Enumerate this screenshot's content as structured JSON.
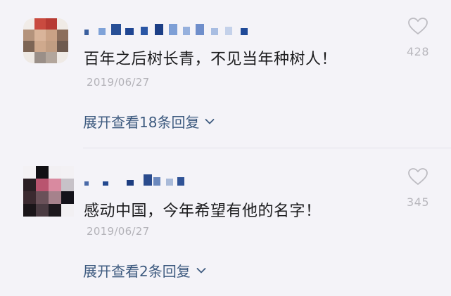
{
  "comments": [
    {
      "text": "百年之后树长青，不见当年种树人！",
      "date": "2019/06/27",
      "likes": "428",
      "expand_label": "展开查看18条回复"
    },
    {
      "text": "感动中国，今年希望有他的名字！",
      "date": "2019/06/27",
      "likes": "345",
      "expand_label": "展开查看2条回复"
    }
  ],
  "icons": {
    "like": "heart-outline-icon",
    "expand": "chevron-down-icon"
  },
  "colors": {
    "background": "#f4f3f8",
    "text": "#1c1c1e",
    "meta": "#b3b2b8",
    "link": "#3d5a7f"
  }
}
